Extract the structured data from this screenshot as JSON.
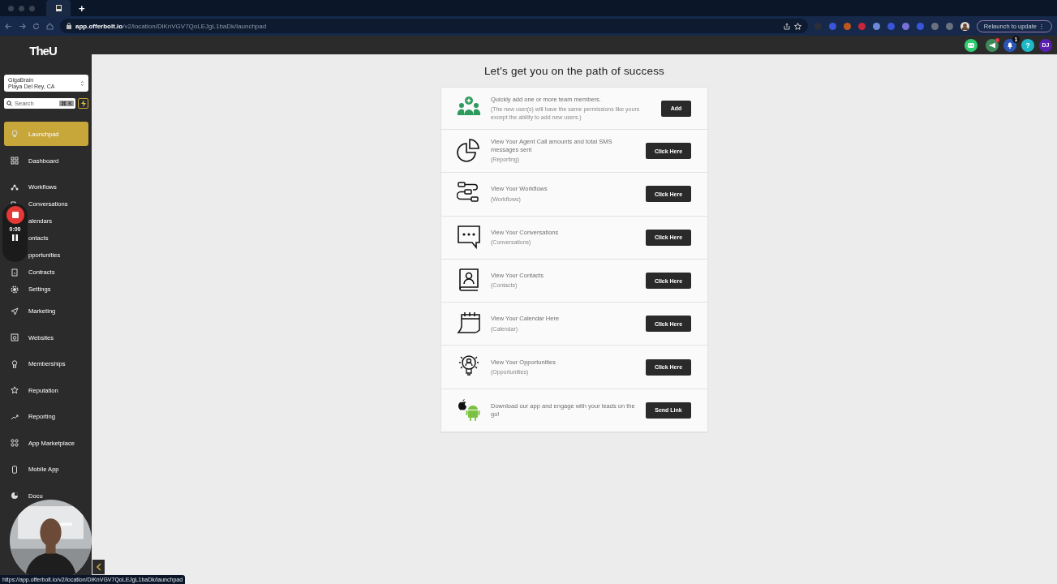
{
  "browser": {
    "new_tab": "+",
    "url": "**app.offerbolt.io**/v2/location/DlKnVGV7QoLEJgL1baDk/launchpad",
    "relaunch": "Relaunch to update",
    "relaunch_menu": "⋮"
  },
  "sidebar": {
    "logo": "TheU",
    "location": {
      "name": "GigaBrain",
      "address": "Playa Del Rey, CA"
    },
    "search": {
      "placeholder": "Search",
      "shortcut": "⌘ K"
    },
    "groups": [
      {
        "items": [
          {
            "label": "Launchpad",
            "selected": true
          }
        ]
      },
      {
        "items": [
          {
            "label": "Dashboard",
            "selected": false
          }
        ]
      },
      {
        "items": [
          {
            "label": "Workflows",
            "selected": false
          },
          {
            "label": "Conversations",
            "selected": false
          },
          {
            "label": "alendars",
            "selected": false
          },
          {
            "label": "ontacts",
            "selected": false
          },
          {
            "label": "pportunities",
            "selected": false
          },
          {
            "label": "Contracts",
            "selected": false
          },
          {
            "label": "Settings",
            "selected": false
          }
        ]
      },
      {
        "items": [
          {
            "label": "Marketing",
            "selected": false
          },
          {
            "label": "Websites",
            "selected": false
          },
          {
            "label": "Memberships",
            "selected": false
          },
          {
            "label": "Reputation",
            "selected": false
          },
          {
            "label": "Reporting",
            "selected": false
          },
          {
            "label": "App Marketplace",
            "selected": false
          },
          {
            "label": "Mobile App",
            "selected": false
          },
          {
            "label": "Docu",
            "selected": false
          }
        ]
      }
    ]
  },
  "header": {
    "notifications": "1",
    "help": "?",
    "avatar": "DJ"
  },
  "recorder": {
    "time": "0:00"
  },
  "launchpad": {
    "title": "Let's get you on the path of success",
    "rows": [
      {
        "title": "Quickly add one or more team members.",
        "note": "(The new user(s) will have the same permissions like yours except the ability to add new users.)",
        "button": "Add"
      },
      {
        "title": "View Your Agent Call amounts and total SMS messages sent",
        "note": "(Reporting)",
        "button": "Click Here"
      },
      {
        "title": "View Your Workflows",
        "note": "(Workflows)",
        "button": "Click Here"
      },
      {
        "title": "View Your Conversations",
        "note": "(Conversations)",
        "button": "Click Here"
      },
      {
        "title": "View Your Contacts",
        "note": "(Contacts)",
        "button": "Click Here"
      },
      {
        "title": "View Your Calendar Here",
        "note": "(Calendar)",
        "button": "Click Here"
      },
      {
        "title": "View Your Opportunities",
        "note": "(Opportunities)",
        "button": "Click Here"
      },
      {
        "title": "Download our app and engage with your leads on the go!",
        "button": "Send Link"
      }
    ]
  },
  "status_bar": "https://app.offerbolt.io/v2/location/DlKnVGV7QoLEJgL1baDk/launchpad"
}
